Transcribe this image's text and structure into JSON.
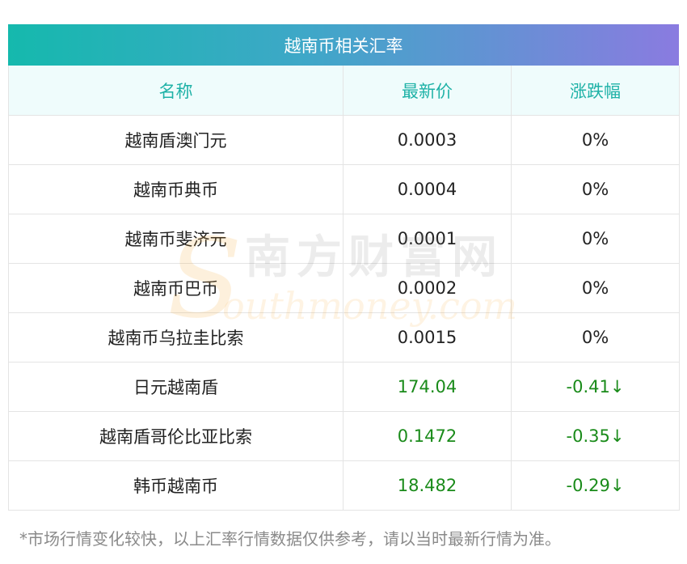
{
  "table": {
    "title": "越南币相关汇率",
    "headers": [
      "名称",
      "最新价",
      "涨跌幅"
    ],
    "rows": [
      {
        "name": "越南盾澳门元",
        "price": "0.0003",
        "change": "0%",
        "trend": "flat"
      },
      {
        "name": "越南币典币",
        "price": "0.0004",
        "change": "0%",
        "trend": "flat"
      },
      {
        "name": "越南币斐济元",
        "price": "0.0001",
        "change": "0%",
        "trend": "flat"
      },
      {
        "name": "越南币巴币",
        "price": "0.0002",
        "change": "0%",
        "trend": "flat"
      },
      {
        "name": "越南币乌拉圭比索",
        "price": "0.0015",
        "change": "0%",
        "trend": "flat"
      },
      {
        "name": "日元越南盾",
        "price": "174.04",
        "change": "-0.41↓",
        "trend": "down"
      },
      {
        "name": "越南盾哥伦比亚比索",
        "price": "0.1472",
        "change": "-0.35↓",
        "trend": "down"
      },
      {
        "name": "韩币越南币",
        "price": "18.482",
        "change": "-0.29↓",
        "trend": "down"
      }
    ]
  },
  "watermark": {
    "letter": "S",
    "chinese": "南方财富网",
    "english": "outhmoney.com"
  },
  "footnote": "*市场行情变化较快，以上汇率行情数据仅供参考，请以当时最新行情为准。",
  "colors": {
    "header_text": "#1fb2a7",
    "header_bg": "#effcfc",
    "down": "#1a8b1a",
    "gradient_start": "#15b9ad",
    "gradient_end": "#8a7be0"
  }
}
